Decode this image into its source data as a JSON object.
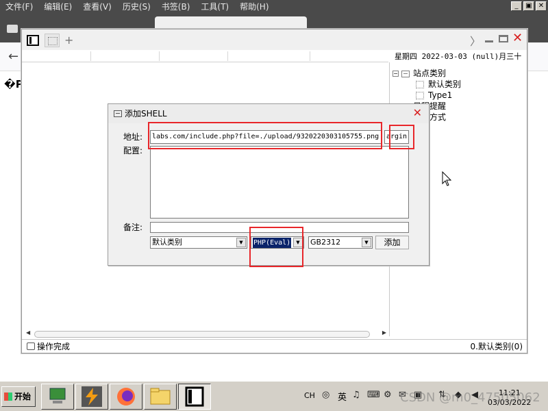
{
  "browser": {
    "menu": [
      "文件(F)",
      "编辑(E)",
      "查看(V)",
      "历史(S)",
      "书签(B)",
      "工具(T)",
      "帮助(H)"
    ],
    "window_controls": [
      "_",
      "▣",
      "✕"
    ],
    "tab_title": "",
    "content_glyph": "�P"
  },
  "app": {
    "date_text": "星期四 2022-03-03 (null)月三十",
    "tree": {
      "root_label": "站点类别",
      "children": [
        "默认类别",
        "Type1"
      ],
      "item_2": "日程提醒",
      "item_3": "快捷方式"
    },
    "status_left": "操作完成",
    "status_right": "0.默认类别(0)"
  },
  "dialog": {
    "title": "添加SHELL",
    "address_label": "地址:",
    "config_label": "配置:",
    "note_label": "备注:",
    "url_value": "labs.com/include.php?file=./upload/9320220303105755.png",
    "password_value": "argin",
    "category_value": "默认类别",
    "script_type_value": "PHP(Eval)",
    "encoding_value": "GB2312",
    "add_label": "添加"
  },
  "taskbar": {
    "start_label": "开始",
    "lang": "CH",
    "ime": "英",
    "clock_time": "11:21",
    "clock_date": "03/03/2022",
    "watermark": "CSDN @m0_47505062"
  },
  "colors": {
    "annotation_red": "#e8262a",
    "close_red": "#d81e1e",
    "selection_blue": "#0a246a"
  }
}
